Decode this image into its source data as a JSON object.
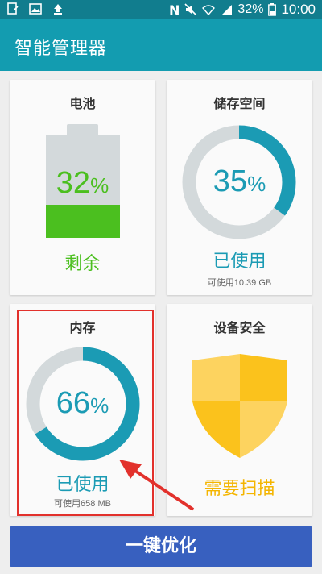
{
  "status_bar": {
    "battery_percent": "32%",
    "time": "10:00",
    "icons": [
      "notes-icon",
      "image-icon",
      "upload-icon",
      "nfc-icon",
      "mute-icon",
      "wifi-icon",
      "signal-icon",
      "battery-icon"
    ]
  },
  "app_bar": {
    "title": "智能管理器"
  },
  "battery": {
    "title": "电池",
    "percent": "32",
    "percent_sign": "%",
    "level": 0.32,
    "status": "剩余",
    "color": "#4bbf1f"
  },
  "storage": {
    "title": "储存空间",
    "percent": "35",
    "percent_sign": "%",
    "used_fraction": 0.35,
    "used_label": "已使用",
    "available": "可使用10.39 GB"
  },
  "memory": {
    "title": "内存",
    "percent": "66",
    "percent_sign": "%",
    "used_fraction": 0.66,
    "used_label": "已使用",
    "available": "可使用658 MB"
  },
  "security": {
    "title": "设备安全",
    "status": "需要扫描",
    "color": "#f4b500"
  },
  "action": {
    "optimize_label": "一键优化"
  },
  "colors": {
    "accent": "#1b9bb4",
    "appbar": "#139cb0",
    "button": "#3860bf",
    "highlight": "#e2312c"
  }
}
